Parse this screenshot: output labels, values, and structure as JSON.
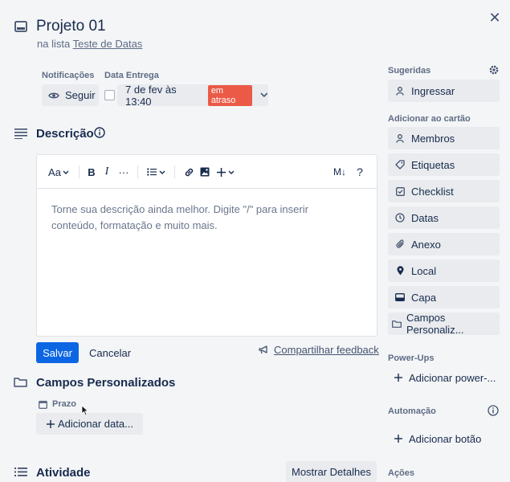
{
  "card": {
    "title": "Projeto 01",
    "in_list_prefix": "na lista",
    "list_name": "Teste de Datas"
  },
  "header": {
    "notifications_label": "Notificações",
    "follow_label": "Seguir",
    "due_date_label": "Data Entrega",
    "due_date_value": "7 de fev às 13:40",
    "overdue_badge": "em atraso"
  },
  "description": {
    "title": "Descrição",
    "toolbar": {
      "text_style": "Aa",
      "bold": "B",
      "italic": "I",
      "more": "···",
      "markdown": "M↓",
      "help": "?"
    },
    "placeholder": "Torne sua descrição ainda melhor. Digite \"/\" para inserir conteúdo, formatação e muito mais.",
    "save_label": "Salvar",
    "cancel_label": "Cancelar",
    "feedback_label": "Compartilhar feedback"
  },
  "custom_fields": {
    "title": "Campos Personalizados",
    "field_name": "Prazo",
    "add_date_label": "Adicionar data..."
  },
  "activity": {
    "title": "Atividade",
    "show_details_label": "Mostrar Detalhes"
  },
  "sidebar": {
    "suggested_label": "Sugeridas",
    "join_label": "Ingressar",
    "add_to_card_label": "Adicionar ao cartão",
    "add_items": [
      {
        "label": "Membros",
        "icon": "person-icon"
      },
      {
        "label": "Etiquetas",
        "icon": "tag-icon"
      },
      {
        "label": "Checklist",
        "icon": "checklist-icon"
      },
      {
        "label": "Datas",
        "icon": "clock-icon"
      },
      {
        "label": "Anexo",
        "icon": "paperclip-icon"
      },
      {
        "label": "Local",
        "icon": "location-pin-icon"
      },
      {
        "label": "Capa",
        "icon": "cover-icon"
      },
      {
        "label": "Campos Personaliz...",
        "icon": "custom-fields-icon"
      }
    ],
    "powerups_label": "Power-Ups",
    "add_powerup_label": "Adicionar power-...",
    "automation_label": "Automação",
    "add_button_label": "Adicionar botão",
    "actions_label": "Ações"
  },
  "colors": {
    "primary": "#0c66e4",
    "overdue": "#eb5a46",
    "background": "#f4f5f7",
    "button_grey": "#e9ebee"
  }
}
